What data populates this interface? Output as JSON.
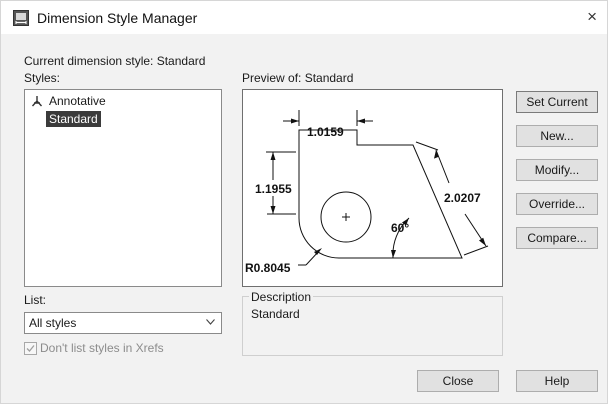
{
  "window": {
    "title": "Dimension Style Manager",
    "close_glyph": "×"
  },
  "labels": {
    "current_style": "Current dimension style: Standard",
    "styles": "Styles:",
    "preview": "Preview of: Standard",
    "list": "List:"
  },
  "styles": [
    {
      "name": "Annotative",
      "icon": "annotative-icon",
      "selected": false
    },
    {
      "name": "Standard",
      "selected": true
    }
  ],
  "list_filter": {
    "value": "All styles"
  },
  "xref_checkbox": {
    "label": "Don't list styles in Xrefs",
    "checked": true,
    "enabled": false
  },
  "preview_dims": {
    "width": "1.0159",
    "height": "1.1955",
    "slant": "2.0207",
    "angle": "60°",
    "radius": "R0.8045"
  },
  "description": {
    "title": "Description",
    "text": "Standard"
  },
  "buttons": {
    "set_current": "Set Current",
    "new": "New...",
    "modify": "Modify...",
    "override": "Override...",
    "compare": "Compare...",
    "close": "Close",
    "help": "Help"
  }
}
